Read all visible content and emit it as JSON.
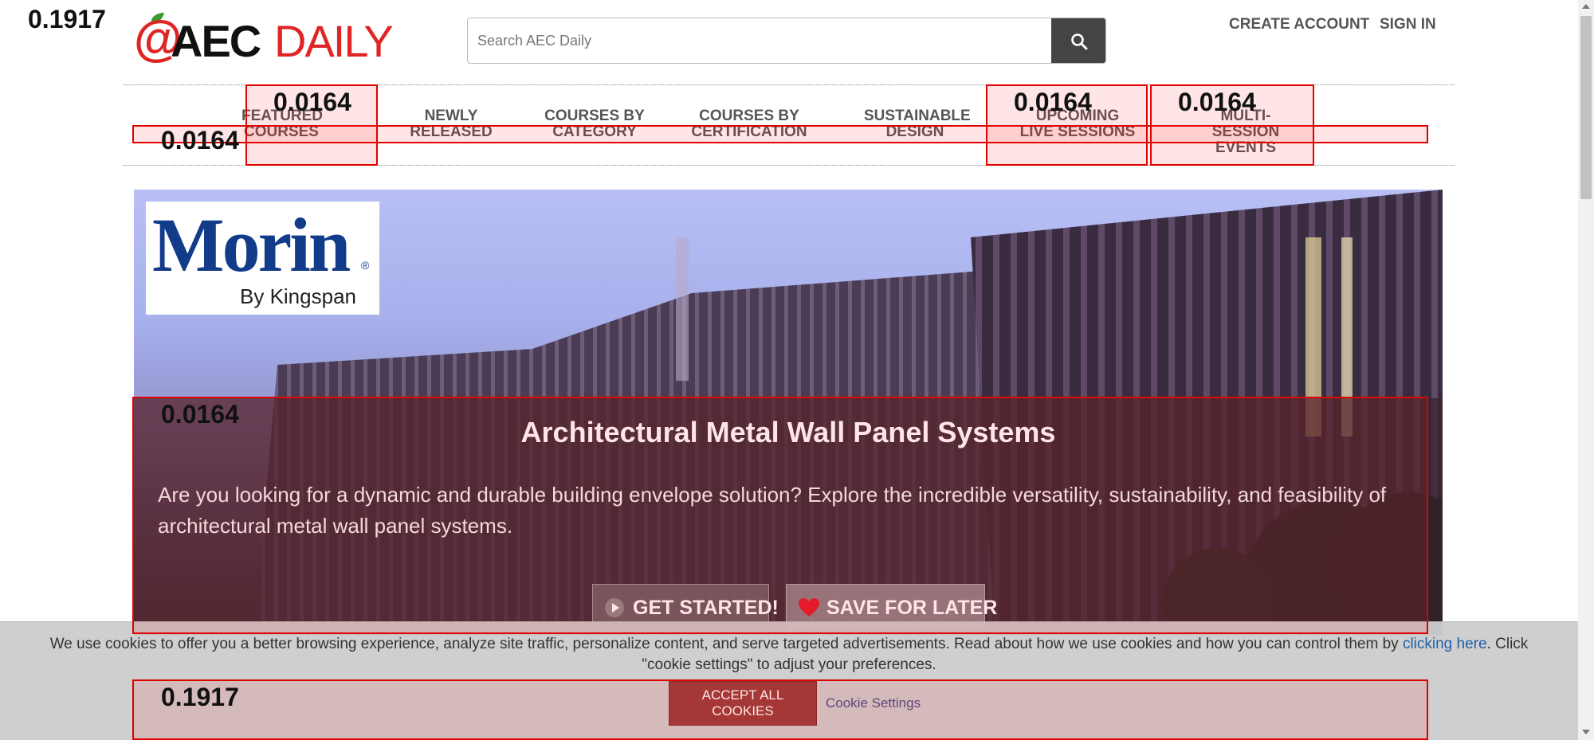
{
  "header": {
    "logo_at": "@",
    "logo_aec": "AEC",
    "logo_daily": "DAILY",
    "search_placeholder": "Search AEC Daily",
    "create_account": "CREATE ACCOUNT",
    "sign_in": "SIGN IN"
  },
  "nav": {
    "items": [
      {
        "line1": "FEATURED",
        "line2": "COURSES"
      },
      {
        "line1": "NEWLY",
        "line2": "RELEASED"
      },
      {
        "line1": "COURSES BY",
        "line2": "CATEGORY"
      },
      {
        "line1": "COURSES BY",
        "line2": "CERTIFICATION"
      },
      {
        "line1": "SUSTAINABLE",
        "line2": "DESIGN"
      },
      {
        "line1": "UPCOMING",
        "line2": "LIVE SESSIONS"
      },
      {
        "line1": "MULTI-SESSION",
        "line2": "EVENTS"
      }
    ]
  },
  "hero": {
    "sponsor_name": "Morin",
    "sponsor_tagline": "By Kingspan",
    "sponsor_reg": "®",
    "title": "Architectural Metal Wall Panel Systems",
    "description": "Are you looking for a dynamic and durable building envelope solution? Explore the incredible versatility, sustainability, and feasibility of architectural metal wall panel systems.",
    "get_started": "GET STARTED!",
    "save_for_later": "SAVE FOR LATER"
  },
  "cookie": {
    "icon": "",
    "text_before": "We use cookies to offer you a better browsing experience, analyze site traffic, personalize content, and serve targeted advertisements. Read about how we use cookies and how you can control them by ",
    "link": "clicking here",
    "text_after": ". Click \"cookie settings\" to adjust your preferences.",
    "accept": "ACCEPT ALL COOKIES",
    "settings": "Cookie Settings"
  },
  "scores": {
    "page": "0.1917",
    "nav_bar": "0.0164",
    "featured": "0.0164",
    "upcoming": "0.0164",
    "multi": "0.0164",
    "hero_panel": "0.0164",
    "cookie_actions": "0.1917"
  },
  "colors": {
    "brand_red": "#e02525",
    "sponsor_blue": "#123b8a",
    "overlay_red": "#e00000"
  }
}
